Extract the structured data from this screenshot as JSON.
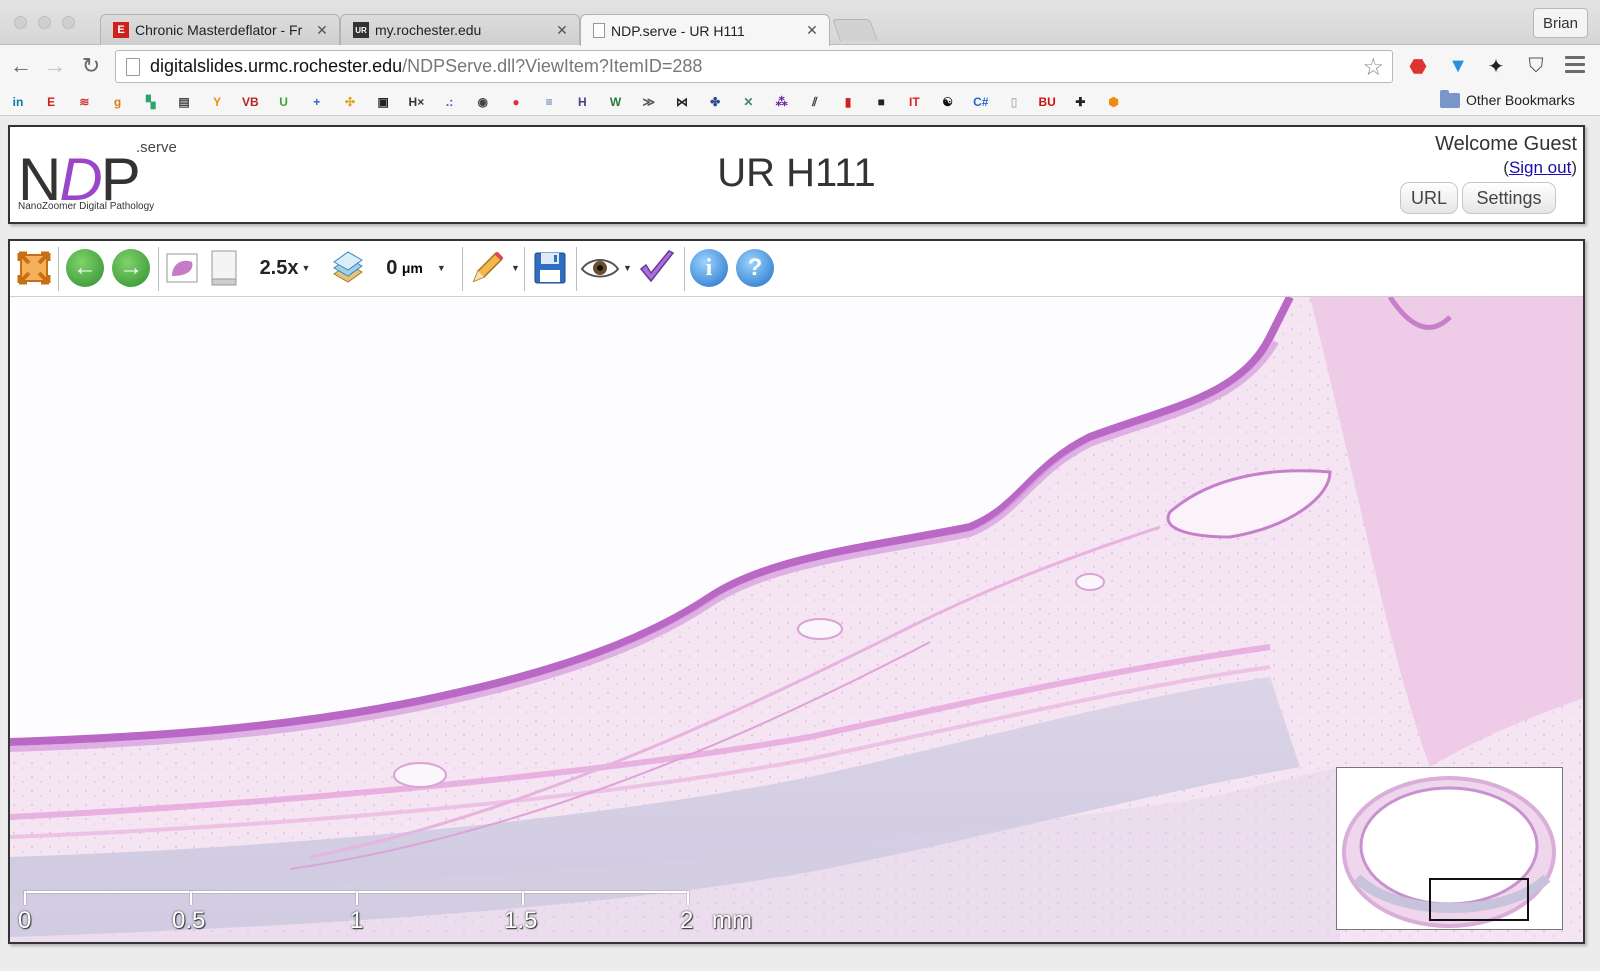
{
  "browser": {
    "tabs": [
      {
        "label": "Chronic Masterdeflator - Fr",
        "icon": "E",
        "active": false
      },
      {
        "label": "my.rochester.edu",
        "icon": "ur-icon",
        "active": false
      },
      {
        "label": "NDP.serve - UR H111",
        "icon": "page-icon",
        "active": true
      }
    ],
    "profile_name": "Brian",
    "url_host": "digitalslides.urmc.rochester.edu",
    "url_path": "/NDPServe.dll?ViewItem?ItemID=288",
    "other_bookmarks_label": "Other Bookmarks",
    "bookmark_glyphs": [
      "in",
      "E",
      "≋",
      "g",
      "▚",
      "▤",
      "Y",
      "VB",
      "U",
      "+",
      "✣",
      "▣",
      "H×",
      ".:",
      "◉",
      "●",
      "≡",
      "H",
      "W",
      "≫",
      "⋈",
      "✤",
      "✕",
      "⁂",
      "⫽",
      "▮",
      "■",
      "IT",
      "☯",
      "C#",
      "▯",
      "BU",
      "✚",
      "⬢"
    ]
  },
  "ndp": {
    "logo_text_n": "N",
    "logo_text_d": "D",
    "logo_text_p": "P",
    "logo_serve": ".serve",
    "logo_subtitle": "NanoZoomer Digital Pathology",
    "title": "UR H111",
    "welcome": "Welcome Guest",
    "signout_open": "(",
    "signout_link": "Sign out",
    "signout_close": ")",
    "url_button": "URL",
    "settings_button": "Settings"
  },
  "viewer": {
    "zoom": "2.5x",
    "focus_value": "0",
    "focus_unit": "μm",
    "scale_labels": [
      "0",
      "0.5",
      "1",
      "1.5",
      "2"
    ],
    "scale_unit": "mm"
  },
  "colors": {
    "tissue_light": "#f1d6ee",
    "tissue_mid": "#e6b6df",
    "tissue_dark": "#b55fbf",
    "cartilage": "#cfcde3",
    "accent_green": "#3aa13a",
    "accent_blue": "#1f7ad0"
  }
}
